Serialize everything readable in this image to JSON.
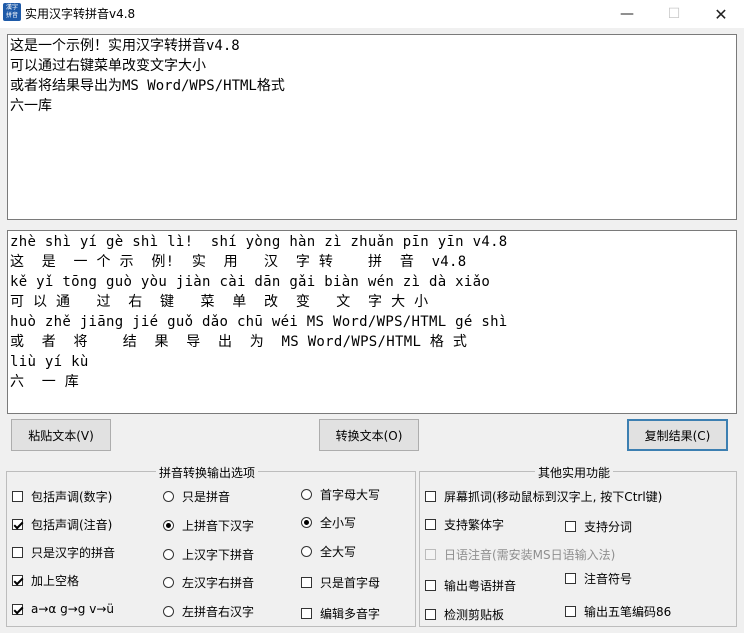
{
  "window": {
    "title": "实用汉字转拼音v4.8",
    "icon_text": "漢字 拼音",
    "minimize_glyph": "—",
    "maximize_glyph": "☐",
    "close_glyph": "✕"
  },
  "input": {
    "lines": [
      "这是一个示例！实用汉字转拼音v4.8",
      "可以通过右键菜单改变文字大小",
      "或者将结果导出为MS Word/WPS/HTML格式",
      "六一库"
    ]
  },
  "output": {
    "lines": [
      "zhè shì yí gè shì lì!  shí yòng hàn zì zhuǎn pīn yīn v4.8",
      "这  是  一 个 示  例!  实  用   汉  字 转    拼  音  v4.8",
      "kě yǐ tōng guò yòu jiàn cài dān gǎi biàn wén zì dà xiǎo",
      "可 以 通   过  右  键   菜  单  改  变   文  字 大 小",
      "huò zhě jiāng jié guǒ dǎo chū wéi MS Word/WPS/HTML gé shì",
      "或  者  将    结  果  导  出  为  MS Word/WPS/HTML 格 式",
      "liù yí kù",
      "六  一 库"
    ]
  },
  "buttons": {
    "paste": "粘贴文本(V)",
    "convert": "转换文本(O)",
    "copy": "复制结果(C)"
  },
  "pinyin_options": {
    "title": "拼音转换输出选项",
    "tone_digits": {
      "label": "包括声调(数字)",
      "checked": false
    },
    "tone_marks": {
      "label": "包括声调(注音)",
      "checked": true
    },
    "only_hanzi_pinyin": {
      "label": "只是汉字的拼音",
      "checked": false
    },
    "add_spaces": {
      "label": "加上空格",
      "checked": true
    },
    "letter_map": {
      "label": "a→α g→g v→ü",
      "checked": true
    },
    "layout_radios": [
      {
        "label": "只是拼音",
        "checked": false
      },
      {
        "label": "上拼音下汉字",
        "checked": true
      },
      {
        "label": "上汉字下拼音",
        "checked": false
      },
      {
        "label": "左汉字右拼音",
        "checked": false
      },
      {
        "label": "左拼音右汉字",
        "checked": false
      }
    ],
    "case_radios": [
      {
        "label": "首字母大写",
        "checked": false
      },
      {
        "label": "全小写",
        "checked": true
      },
      {
        "label": "全大写",
        "checked": false
      }
    ],
    "initial_only": {
      "label": "只是首字母",
      "checked": false
    },
    "edit_polyphones": {
      "label": "编辑多音字",
      "checked": false
    }
  },
  "other_tools": {
    "title": "其他实用功能",
    "screen_capture": {
      "label": "屏幕抓词(移动鼠标到汉字上, 按下Ctrl键)",
      "checked": false
    },
    "traditional": {
      "label": "支持繁体字",
      "checked": false
    },
    "word_segmentation": {
      "label": "支持分词",
      "checked": false
    },
    "japanese": {
      "label": "日语注音(需安装MS日语输入法)",
      "checked": false,
      "disabled": true
    },
    "cantonese": {
      "label": "输出粤语拼音",
      "checked": false
    },
    "zhuyin": {
      "label": "注音符号",
      "checked": false
    },
    "clipboard_monitor": {
      "label": "检测剪贴板",
      "checked": false
    },
    "wubi": {
      "label": "输出五笔编码86",
      "checked": false
    }
  }
}
